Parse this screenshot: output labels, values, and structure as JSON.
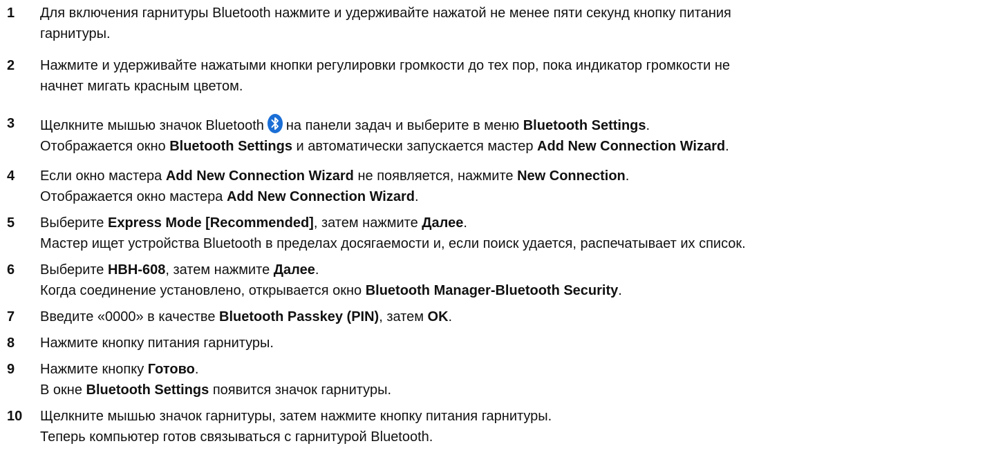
{
  "steps": [
    {
      "num": "1",
      "line1": "Для включения гарнитуры Bluetooth нажмите и удерживайте нажатой не менее пяти секунд кнопку питания",
      "line2": "гарнитуры."
    },
    {
      "num": "2",
      "line1": "Нажмите и удерживайте нажатыми кнопки регулировки громкости до тех пор, пока индикатор громкости не",
      "line2": "начнет мигать красным цветом."
    },
    {
      "num": "3",
      "l1_a": "Щелкните мышью значок Bluetooth",
      "l1_b": "на панели задач и выберите в меню",
      "l1_c": "Bluetooth Settings",
      "l1_d": ".",
      "l2_a": "Отображается окно",
      "l2_b": "Bluetooth Settings",
      "l2_c": "и автоматически запускается мастер",
      "l2_d": "Add New Connection Wizard",
      "l2_e": "."
    },
    {
      "num": "4",
      "l1_a": "Если окно мастера",
      "l1_b": "Add New Connection Wizard",
      "l1_c": "не появляется, нажмите",
      "l1_d": "New Connection",
      "l1_e": ".",
      "l2_a": "Отображается окно мастера",
      "l2_b": "Add New Connection Wizard",
      "l2_c": "."
    },
    {
      "num": "5",
      "l1_a": "Выберите",
      "l1_b": "Express Mode [Recommended]",
      "l1_c": ", затем нажмите",
      "l1_d": "Далее",
      "l1_e": ".",
      "line2": "Мастер ищет устройства Bluetooth в пределах досягаемости и, если поиск удается, распечатывает их список."
    },
    {
      "num": "6",
      "l1_a": "Выберите",
      "l1_b": "HBH-608",
      "l1_c": ", затем нажмите",
      "l1_d": "Далее",
      "l1_e": ".",
      "l2_a": "Когда соединение установлено, открывается окно",
      "l2_b": "Bluetooth Manager-Bluetooth Security",
      "l2_c": "."
    },
    {
      "num": "7",
      "l1_a": "Введите «0000» в качестве",
      "l1_b": "Bluetooth Passkey (PIN)",
      "l1_c": ", затем",
      "l1_d": "OK",
      "l1_e": "."
    },
    {
      "num": "8",
      "line1": "Нажмите кнопку питания гарнитуры."
    },
    {
      "num": "9",
      "l1_a": "Нажмите кнопку",
      "l1_b": "Готово",
      "l1_c": ".",
      "l2_a": "В окне",
      "l2_b": "Bluetooth Settings",
      "l2_c": "появится значок гарнитуры."
    },
    {
      "num": "10",
      "line1": "Щелкните мышью значок гарнитуры, затем нажмите кнопку питания гарнитуры.",
      "line2": "Теперь компьютер готов связываться с гарнитурой Bluetooth."
    }
  ],
  "icons": {
    "bluetooth": "bluetooth-icon",
    "bluetooth_color": "#1b6fd6"
  }
}
